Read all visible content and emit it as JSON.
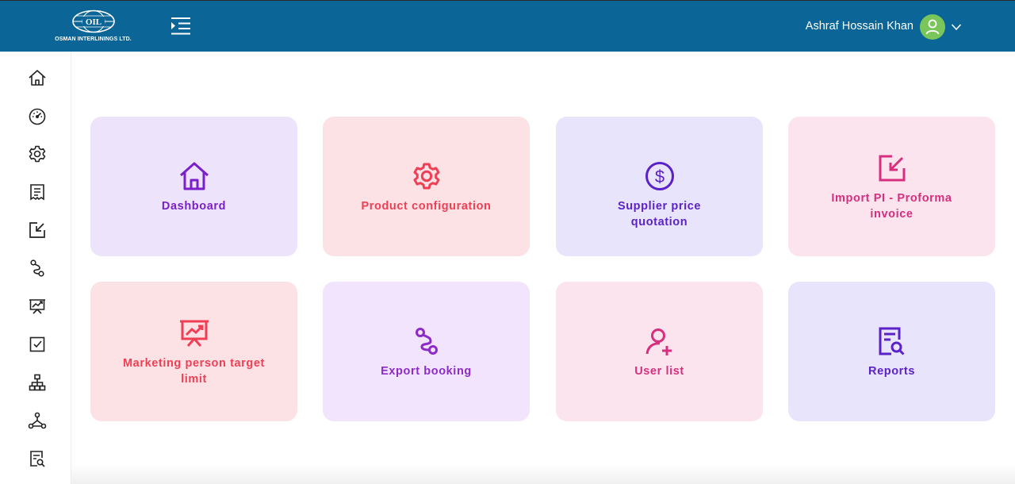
{
  "header": {
    "logo_text": "OSMAN INTERLININGS LTD.",
    "logo_mark": "OIL",
    "user_name": "Ashraf Hossain Khan",
    "colors": {
      "bar": "#0b6596",
      "avatar": "#7ac65b"
    }
  },
  "sidebar": {
    "icons": [
      "home-icon",
      "speedometer-icon",
      "gear-icon",
      "invoice-icon",
      "import-icon",
      "route-icon",
      "presentation-chart-icon",
      "checkbox-icon",
      "org-chart-icon",
      "network-icon",
      "report-search-icon"
    ]
  },
  "cards": [
    {
      "label": "Dashboard",
      "icon": "home-icon",
      "bg": "#ede4fc",
      "fg": "#7a1fc9"
    },
    {
      "label": "Product configuration",
      "icon": "gear-icon",
      "bg": "#fde2e5",
      "fg": "#ef3f55"
    },
    {
      "label": "Supplier price quotation",
      "icon": "dollar-circle-icon",
      "bg": "#e7e4fc",
      "fg": "#5a22c8"
    },
    {
      "label": "Import PI - Proforma invoice",
      "icon": "import-icon",
      "bg": "#fce4ef",
      "fg": "#d62f7d"
    },
    {
      "label": "Marketing person target limit",
      "icon": "presentation-chart-icon",
      "bg": "#fde2e5",
      "fg": "#ef3f55"
    },
    {
      "label": "Export booking",
      "icon": "route-icon",
      "bg": "#f1e4fc",
      "fg": "#8c2bc9"
    },
    {
      "label": "User list",
      "icon": "user-add-icon",
      "bg": "#fce4ef",
      "fg": "#d62f7d"
    },
    {
      "label": "Reports",
      "icon": "report-search-icon",
      "bg": "#e7e4fc",
      "fg": "#5a22c8"
    }
  ]
}
